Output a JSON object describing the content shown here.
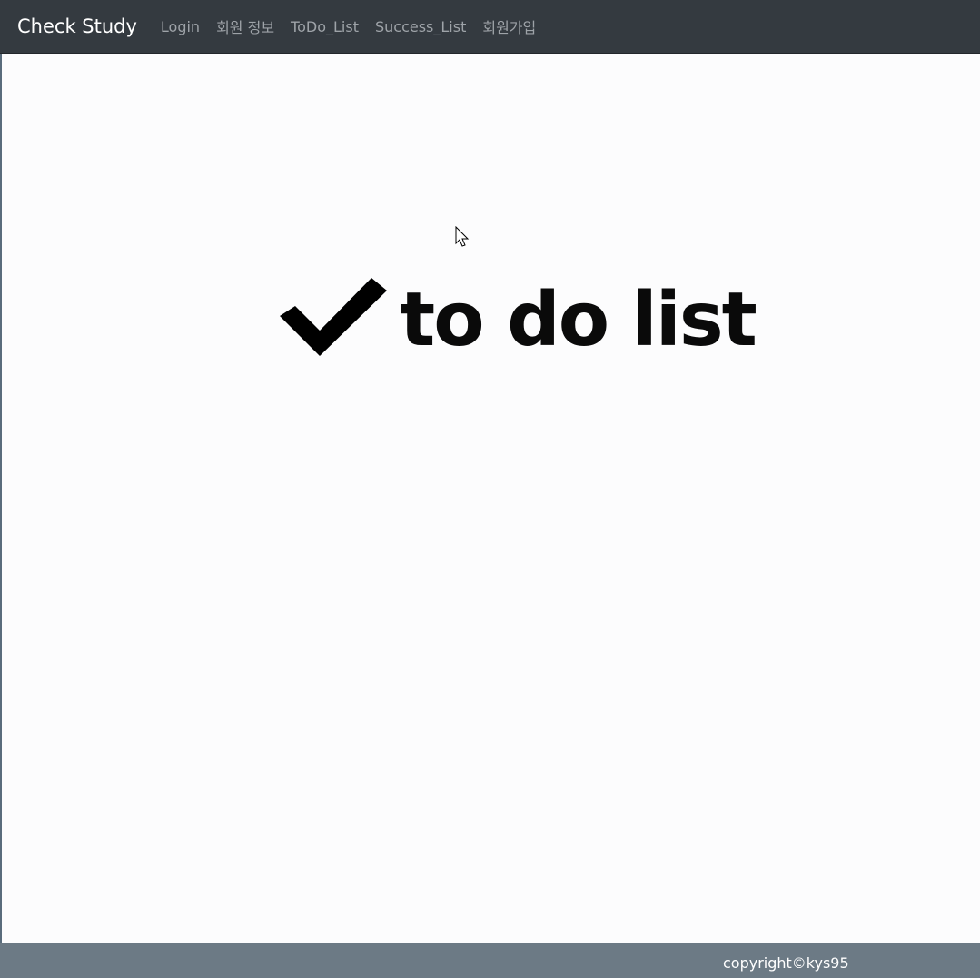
{
  "navbar": {
    "brand": "Check Study",
    "links": [
      {
        "label": "Login"
      },
      {
        "label": "회원 정보"
      },
      {
        "label": "ToDo_List"
      },
      {
        "label": "Success_List"
      },
      {
        "label": "회원가입"
      }
    ]
  },
  "hero": {
    "logo_text": "to do list",
    "icon": "checkmark-icon"
  },
  "footer": {
    "copyright": "copyright©kys95"
  },
  "cursor": {
    "icon": "mouse-pointer-icon"
  }
}
